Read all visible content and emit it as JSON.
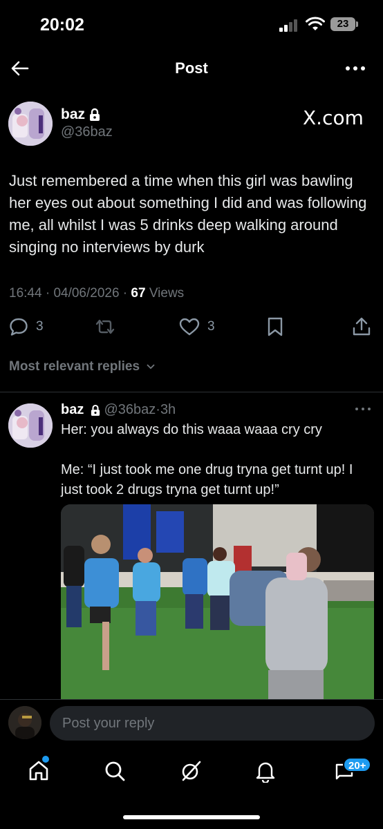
{
  "status_bar": {
    "time": "20:02",
    "battery": "23"
  },
  "header": {
    "title": "Post"
  },
  "post": {
    "author_name": "baz",
    "author_handle": "@36baz",
    "brand": "X.com",
    "text": "Just remembered a time when this girl was bawling her eyes out about something I did and was following me, all whilst I was 5 drinks deep walking around singing no interviews by durk",
    "time": "16:44",
    "date": "04/06/2026",
    "views_count": "67",
    "views_label": "Views",
    "replies": "3",
    "likes": "3"
  },
  "replies_sort": "Most relevant replies",
  "reply": {
    "author_name": "baz",
    "author_handle": "@36baz",
    "time_ago": "3h",
    "line1": "Her: you always do this waaa waaa cry cry",
    "line2": "Me: “I just took me one drug tryna get turnt up! I just took 2 drugs tryna get turnt up!”"
  },
  "composer": {
    "placeholder": "Post your reply"
  },
  "nav": {
    "messages_badge": "20+"
  },
  "icons": {
    "back": "arrow-left-icon",
    "more": "more-horizontal-icon",
    "lock": "lock-icon",
    "reply": "comment-icon",
    "repost": "repost-icon",
    "like": "heart-icon",
    "bookmark": "bookmark-icon",
    "share": "share-icon",
    "home": "home-icon",
    "search": "search-icon",
    "grok": "grok-icon",
    "notifications": "bell-icon",
    "messages": "messages-icon"
  },
  "colors": {
    "background": "#000000",
    "text": "#e7e9ea",
    "muted": "#71767b",
    "accent": "#1d9bf0"
  }
}
